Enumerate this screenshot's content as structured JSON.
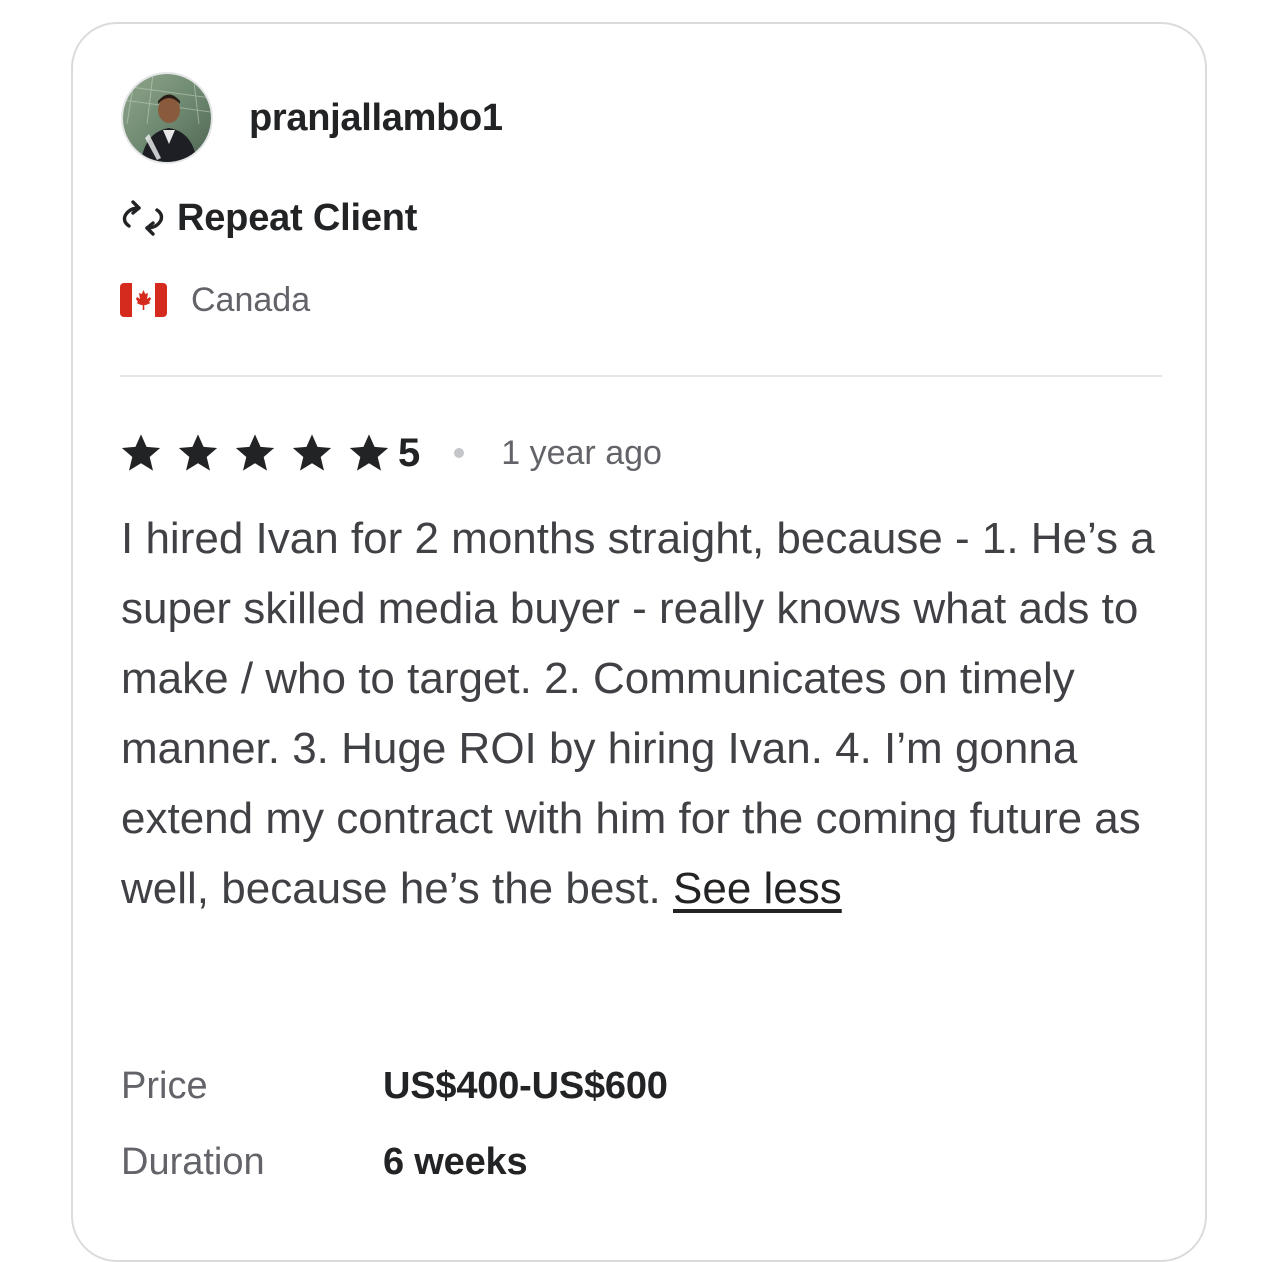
{
  "reviewer": {
    "avatar_icon": "user-avatar-photo",
    "username": "pranjallambo1",
    "badge_icon": "repeat-icon",
    "badge_label": "Repeat Client",
    "country_flag_icon": "canada-flag-icon",
    "country": "Canada"
  },
  "review": {
    "rating": 5,
    "rating_label": "5",
    "star_icon": "star-icon",
    "time_ago": "1 year ago",
    "body": "I hired Ivan for 2 months straight, because - 1. He’s a super skilled media buyer - really knows what ads to make / who to target. 2. Communicates on timely manner. 3. Huge ROI by hiring Ivan. 4. I’m gonna extend my contract with him for the coming future as well, because he’s the best.",
    "toggle_label": "See less"
  },
  "details": {
    "price_label": "Price",
    "price_value": "US$400-US$600",
    "duration_label": "Duration",
    "duration_value": "6 weeks"
  },
  "colors": {
    "text_primary": "#222325",
    "text_secondary": "#62646a",
    "border": "#dadbdd",
    "flag_red": "#d52b1e"
  }
}
